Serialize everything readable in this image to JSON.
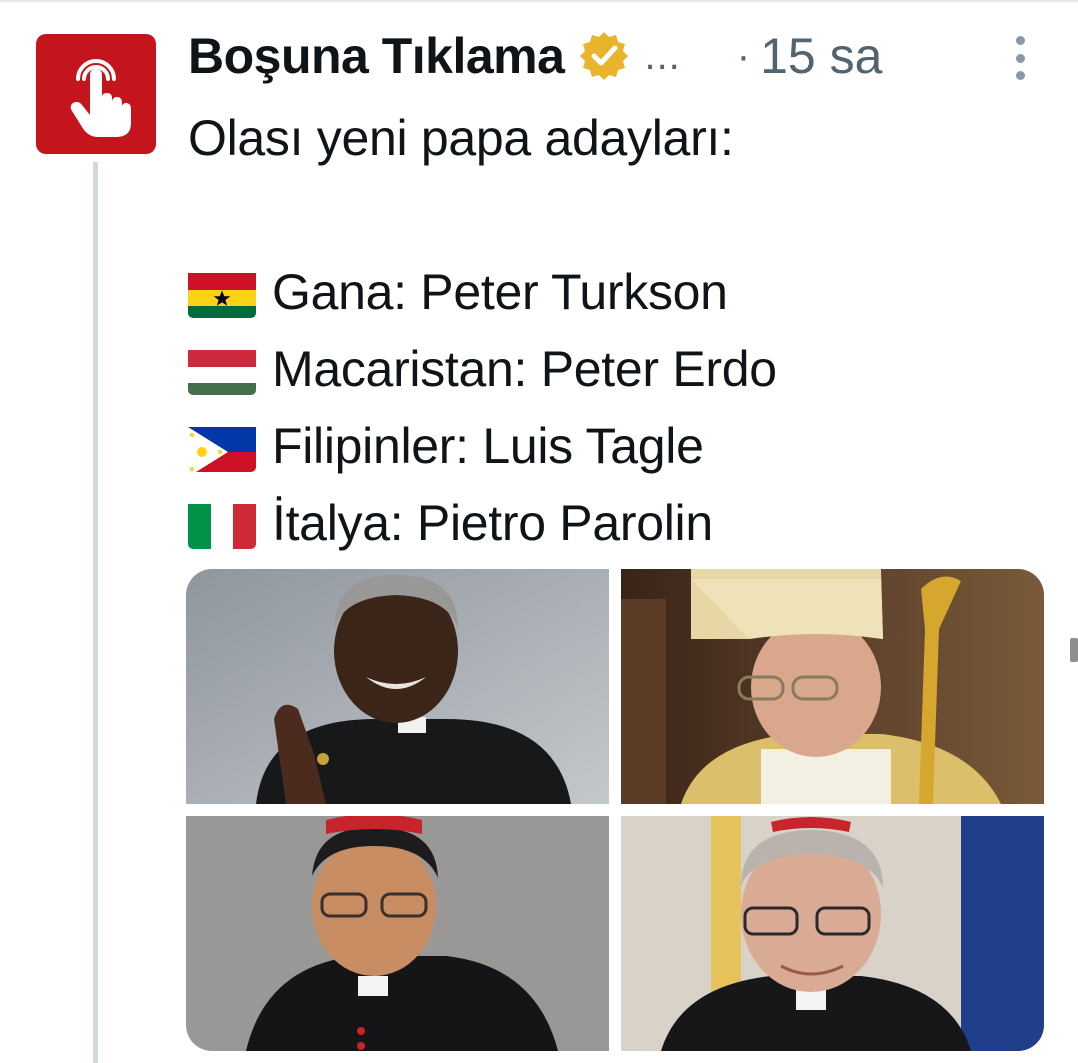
{
  "author": {
    "display_name": "Boşuna Tıklama",
    "truncation": "...",
    "avatar_icon": "tap-finger-icon",
    "verified_icon": "verified-gold-badge-icon"
  },
  "meta": {
    "separator": "·",
    "time": "15 sa"
  },
  "tweet": {
    "intro": "Olası yeni papa adayları:",
    "lines": [
      {
        "flag_icon": "ghana-flag-icon",
        "text": "Gana: Peter Turkson"
      },
      {
        "flag_icon": "hungary-flag-icon",
        "text": "Macaristan: Peter Erdo"
      },
      {
        "flag_icon": "philippines-flag-icon",
        "text": "Filipinler: Luis Tagle"
      },
      {
        "flag_icon": "italy-flag-icon",
        "text": "İtalya: Pietro Parolin"
      }
    ]
  },
  "media": {
    "photos": [
      {
        "name": "photo-peter-turkson"
      },
      {
        "name": "photo-peter-erdo"
      },
      {
        "name": "photo-luis-tagle"
      },
      {
        "name": "photo-pietro-parolin"
      }
    ]
  },
  "colors": {
    "avatar_bg": "#c4151c",
    "verified_gold": "#e8b42c",
    "secondary_text": "#536471",
    "thread_line": "#cfd9de"
  }
}
